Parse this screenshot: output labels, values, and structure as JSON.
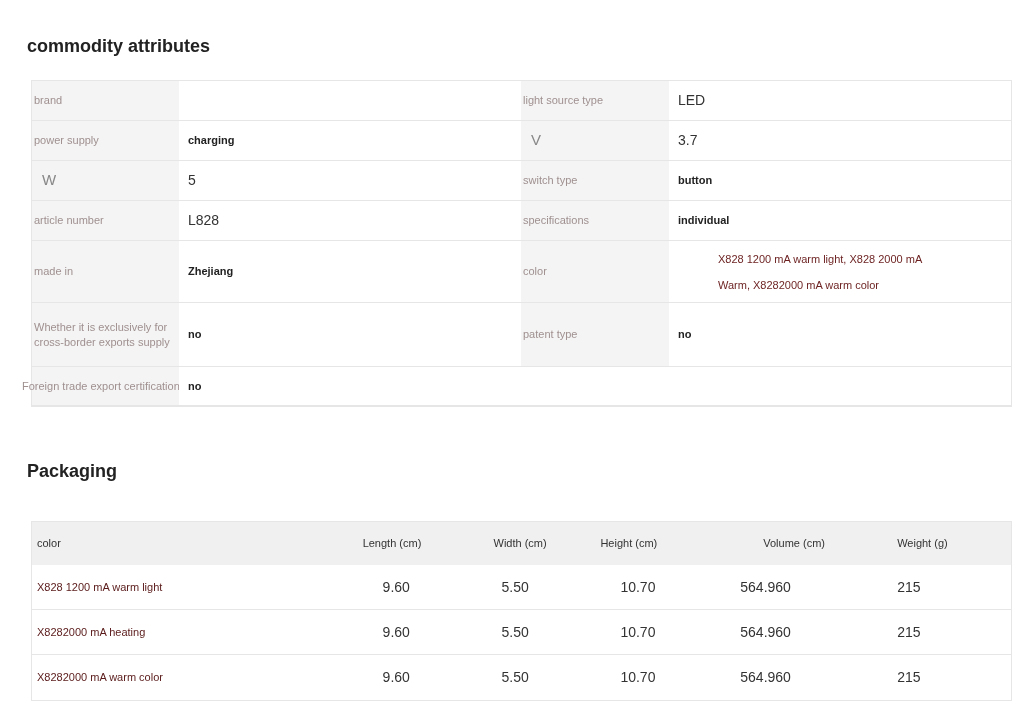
{
  "attributes": {
    "title": "commodity attributes",
    "rows": [
      [
        {
          "label": {
            "text": "brand",
            "kind": "small"
          }
        },
        {
          "label": {
            "text": "light source type",
            "kind": "small"
          },
          "value": "LED",
          "kind": "plain"
        }
      ],
      [
        {
          "label": {
            "text": "power supply",
            "kind": "small"
          },
          "value": "charging",
          "kind": "bold"
        },
        {
          "label": {
            "text": "V",
            "kind": "large"
          },
          "value": "3.7",
          "kind": "plain"
        }
      ],
      [
        {
          "label": {
            "text": "W",
            "kind": "large"
          },
          "value": "5",
          "kind": "plain"
        },
        {
          "label": {
            "text": "switch type",
            "kind": "small"
          },
          "value": "button",
          "kind": "bold"
        }
      ],
      [
        {
          "label": {
            "text": "article number",
            "kind": "small"
          },
          "value": "L828",
          "kind": "plain"
        },
        {
          "label": {
            "text": "specifications",
            "kind": "small"
          },
          "value": "individual",
          "kind": "bold"
        }
      ],
      [
        {
          "label": {
            "text": "made in",
            "kind": "small"
          },
          "value": "Zhejiang",
          "kind": "bold"
        },
        {
          "label": {
            "text": "color",
            "kind": "small"
          },
          "value": "X828 1200 mA warm light, X828 2000 mA Warm, X8282000 mA warm color",
          "kind": "accent"
        }
      ],
      [
        {
          "label": {
            "text": "Whether it is exclusively for cross-border exports  supply",
            "kind": "small"
          },
          "value": "no",
          "kind": "bold"
        },
        {
          "label": {
            "text": "patent type",
            "kind": "small"
          },
          "value": "no",
          "kind": "bold"
        }
      ],
      [
        {
          "label": {
            "text": "Foreign trade export certification",
            "kind": "small"
          },
          "value": "no",
          "kind": "bold"
        }
      ]
    ]
  },
  "packaging": {
    "title": "Packaging",
    "columns": [
      "color",
      "Length (cm)",
      "Width (cm)",
      "Height (cm)",
      "Volume (cm)",
      "Weight (g)"
    ],
    "rows": [
      [
        "X828 1200 mA warm light",
        "9.60",
        "5.50",
        "10.70",
        "564.960",
        "215"
      ],
      [
        "X8282000 mA heating",
        "9.60",
        "5.50",
        "10.70",
        "564.960",
        "215"
      ],
      [
        "X8282000 mA warm color",
        "9.60",
        "5.50",
        "10.70",
        "564.960",
        "215"
      ]
    ]
  }
}
